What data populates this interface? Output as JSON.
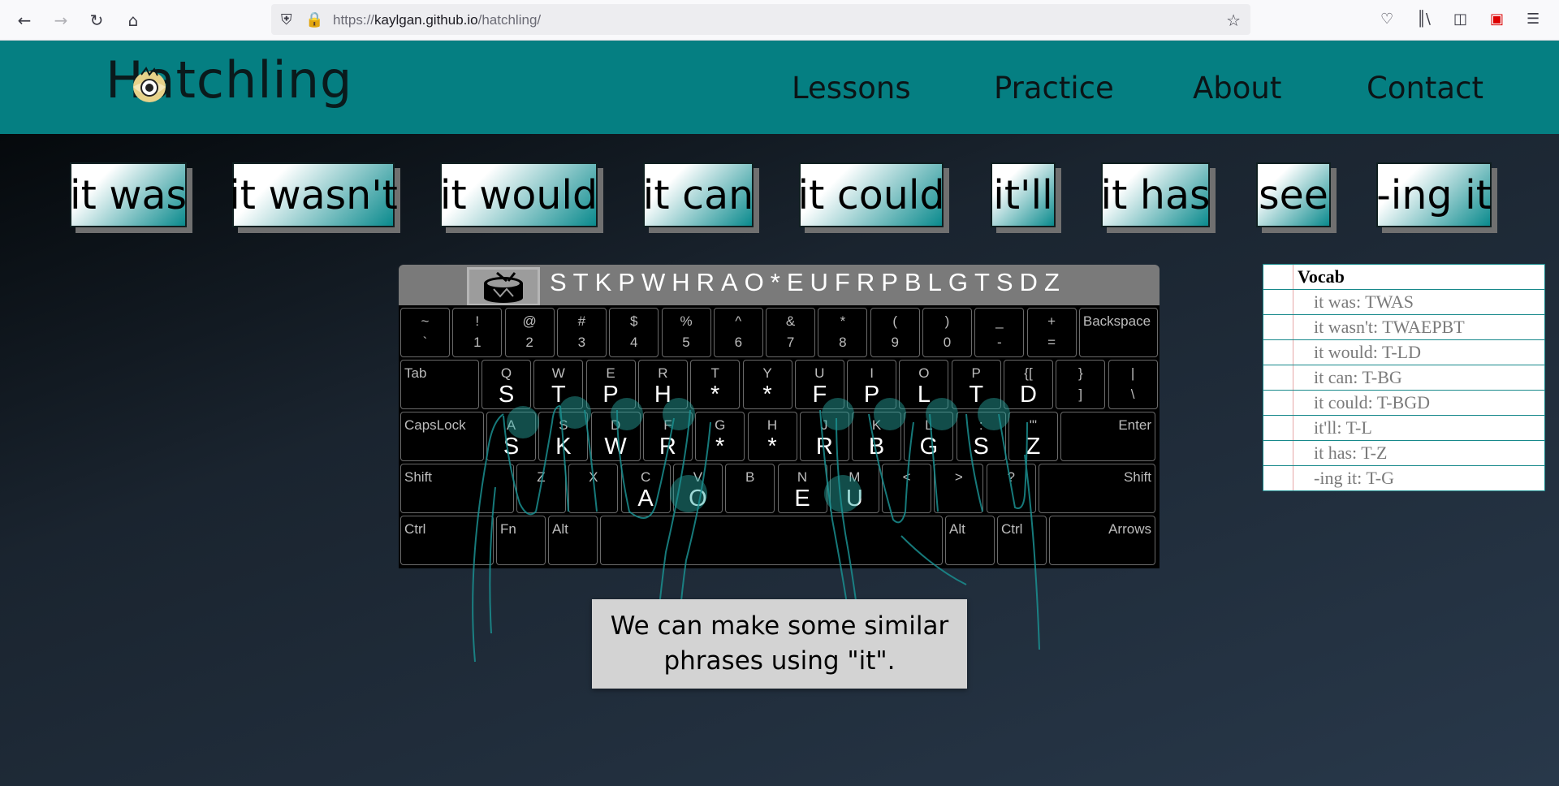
{
  "browser": {
    "url_prefix": "https://",
    "url_host": "kaylgan.github.io",
    "url_path": "/hatchling/",
    "icons": [
      "back-icon",
      "forward-icon",
      "reload-icon",
      "home-icon",
      "shield-icon",
      "lock-icon",
      "star-icon",
      "pocket-icon",
      "library-icon",
      "sidebar-icon",
      "extension-icon",
      "menu-icon"
    ]
  },
  "header": {
    "logo_text": "Hatchling",
    "nav": [
      "Lessons",
      "Practice",
      "About",
      "Contact"
    ],
    "color": "#057f82"
  },
  "phrases": [
    "it was",
    "it wasn't",
    "it would",
    "it can",
    "it could",
    "it'll",
    "it has",
    "see",
    "-ing it"
  ],
  "steno_bar": {
    "icon": "drum-icon",
    "letters": "STKPWHRAO*EUFRPBLGTSDZ"
  },
  "keyboard": {
    "row1": [
      {
        "top": "~",
        "bot": "`"
      },
      {
        "top": "!",
        "bot": "1"
      },
      {
        "top": "@",
        "bot": "2"
      },
      {
        "top": "#",
        "bot": "3"
      },
      {
        "top": "$",
        "bot": "4"
      },
      {
        "top": "%",
        "bot": "5"
      },
      {
        "top": "^",
        "bot": "6"
      },
      {
        "top": "&",
        "bot": "7"
      },
      {
        "top": "*",
        "bot": "8"
      },
      {
        "top": "(",
        "bot": "9"
      },
      {
        "top": ")",
        "bot": "0"
      },
      {
        "top": "_",
        "bot": "-"
      },
      {
        "top": "+",
        "bot": "="
      }
    ],
    "backspace": "Backspace",
    "tab": "Tab",
    "row2": [
      {
        "top": "Q",
        "steno": "S"
      },
      {
        "top": "W",
        "steno": "T"
      },
      {
        "top": "E",
        "steno": "P"
      },
      {
        "top": "R",
        "steno": "H"
      },
      {
        "top": "T",
        "steno": "*"
      },
      {
        "top": "Y",
        "steno": "*"
      },
      {
        "top": "U",
        "steno": "F"
      },
      {
        "top": "I",
        "steno": "P"
      },
      {
        "top": "O",
        "steno": "L"
      },
      {
        "top": "P",
        "steno": "T"
      },
      {
        "top": "{[",
        "steno": "D"
      },
      {
        "top": "}",
        "bot": "]"
      },
      {
        "top": "|",
        "bot": "\\"
      }
    ],
    "capslock": "CapsLock",
    "row3": [
      {
        "top": "A",
        "steno": "S"
      },
      {
        "top": "S",
        "steno": "K"
      },
      {
        "top": "D",
        "steno": "W"
      },
      {
        "top": "F",
        "steno": "R"
      },
      {
        "top": "G",
        "steno": "*"
      },
      {
        "top": "H",
        "steno": "*"
      },
      {
        "top": "J",
        "steno": "R"
      },
      {
        "top": "K",
        "steno": "B"
      },
      {
        "top": "L",
        "steno": "G"
      },
      {
        "top": ":",
        "steno": "S"
      },
      {
        "top": "\"'",
        "steno": "Z"
      }
    ],
    "enter": "Enter",
    "shift_left": "Shift",
    "row4": [
      {
        "top": "Z"
      },
      {
        "top": "X"
      },
      {
        "top": "C",
        "steno": "A"
      },
      {
        "top": "V",
        "steno": "O"
      },
      {
        "top": "B"
      },
      {
        "top": "N",
        "steno": "E"
      },
      {
        "top": "M",
        "steno": "U"
      },
      {
        "top": "<"
      },
      {
        "top": ">"
      },
      {
        "top": "?"
      }
    ],
    "shift_right": "Shift",
    "ctrl": "Ctrl",
    "fn": "Fn",
    "alt": "Alt",
    "alt_right": "Alt",
    "ctrl_right": "Ctrl",
    "arrows": "Arrows"
  },
  "message": {
    "line1": "We can make some similar",
    "line2": "phrases using \"it\"."
  },
  "vocab": {
    "title": "Vocab",
    "items": [
      "it was: TWAS",
      "it wasn't: TWAEPBT",
      "it would: T-LD",
      "it can: T-BG",
      "it could: T-BGD",
      "it'll: T-L",
      "it has: T-Z",
      "-ing it: T-G"
    ]
  }
}
